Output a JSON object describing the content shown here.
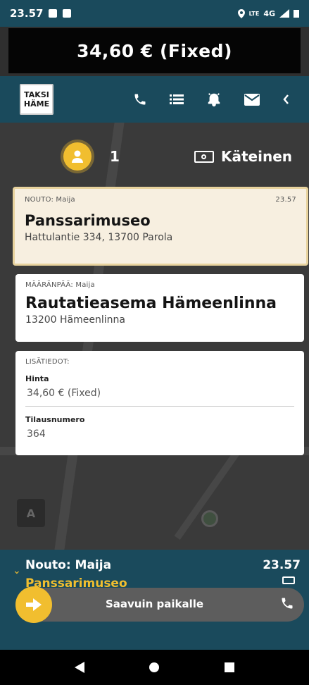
{
  "status_bar": {
    "time": "23.57",
    "network": "4G",
    "volte": "LTE"
  },
  "price_banner": {
    "text": "34,60 € (Fixed)"
  },
  "header": {
    "logo_line1": "TAKSI",
    "logo_line2": "HÄME",
    "icons": [
      "phone-icon",
      "list-icon",
      "alarm-icon",
      "mail-icon",
      "chevron-left-icon"
    ]
  },
  "trip_info": {
    "passenger_count": "1",
    "payment_label": "Käteinen"
  },
  "pickup": {
    "label": "NOUTO: Maija",
    "time": "23.57",
    "place": "Panssarimuseo",
    "address": "Hattulantie 334, 13700 Parola"
  },
  "destination": {
    "label": "MÄÄRÄNPÄÄ: Maija",
    "place": "Rautatieasema Hämeenlinna",
    "address": "13200 Hämeenlinna"
  },
  "extra": {
    "heading": "LISÄTIEDOT:",
    "price_label": "Hinta",
    "price_value": "34,60 € (Fixed)",
    "order_label": "Tilausnumero",
    "order_value": "364"
  },
  "bottom_panel": {
    "title": "Nouto: Maija",
    "subtitle": "Panssarimuseo",
    "time": "23.57",
    "slider_label": "Saavuin paikalle"
  },
  "colors": {
    "primary": "#1a4a5c",
    "accent": "#f1be2f",
    "map": "#3a3a3a"
  }
}
